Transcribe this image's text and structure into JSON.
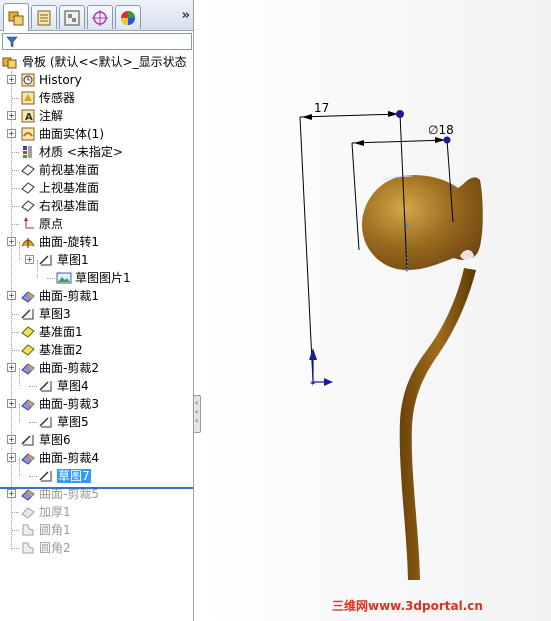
{
  "tabs": [
    {
      "name": "featuremanager"
    },
    {
      "name": "propertymanager"
    },
    {
      "name": "configurationmanager"
    },
    {
      "name": "dimxpertmanager"
    },
    {
      "name": "displaymanager"
    }
  ],
  "tabs_more": "»",
  "tree": {
    "root": "骨板 (默认<<默认>_显示状态",
    "items": [
      {
        "label": "History",
        "icon": "history-icon"
      },
      {
        "label": "传感器",
        "icon": "sensor-icon"
      },
      {
        "label": "注解",
        "icon": "annotation-icon"
      },
      {
        "label": "曲面实体(1)",
        "icon": "surface-bodies-icon"
      },
      {
        "label": "材质 <未指定>",
        "icon": "material-icon"
      },
      {
        "label": "前视基准面",
        "icon": "plane-icon"
      },
      {
        "label": "上视基准面",
        "icon": "plane-icon"
      },
      {
        "label": "右视基准面",
        "icon": "plane-icon"
      },
      {
        "label": "原点",
        "icon": "origin-icon"
      },
      {
        "label": "曲面-旋转1",
        "icon": "surface-revolve-icon"
      },
      {
        "label": "草图1",
        "icon": "sketch-icon"
      },
      {
        "label": "草图图片1",
        "icon": "sketch-picture-icon"
      },
      {
        "label": "曲面-剪裁1",
        "icon": "surface-trim-icon"
      },
      {
        "label": "草图3",
        "icon": "sketch-icon"
      },
      {
        "label": "基准面1",
        "icon": "ref-plane-icon"
      },
      {
        "label": "基准面2",
        "icon": "ref-plane-icon"
      },
      {
        "label": "曲面-剪裁2",
        "icon": "surface-trim-icon"
      },
      {
        "label": "草图4",
        "icon": "sketch-icon"
      },
      {
        "label": "曲面-剪裁3",
        "icon": "surface-trim-icon"
      },
      {
        "label": "草图5",
        "icon": "sketch-icon"
      },
      {
        "label": "草图6",
        "icon": "sketch-icon"
      },
      {
        "label": "曲面-剪裁4",
        "icon": "surface-trim-icon"
      },
      {
        "label": "草图7",
        "icon": "sketch-icon"
      },
      {
        "label": "曲面-剪裁5",
        "icon": "surface-trim-icon"
      },
      {
        "label": "加厚1",
        "icon": "thicken-icon"
      },
      {
        "label": "圆角1",
        "icon": "fillet-icon"
      },
      {
        "label": "圆角2",
        "icon": "fillet-icon"
      }
    ]
  },
  "dimensions": {
    "d1": "17",
    "d2": "∅18"
  },
  "watermark": "三维网www.3dportal.cn",
  "colors": {
    "part": "#8a5a14",
    "part_highlight": "#c89a3a",
    "selection": "#3399ff",
    "rollback_bar": "#3a6fc4",
    "watermark": "#e03020"
  }
}
